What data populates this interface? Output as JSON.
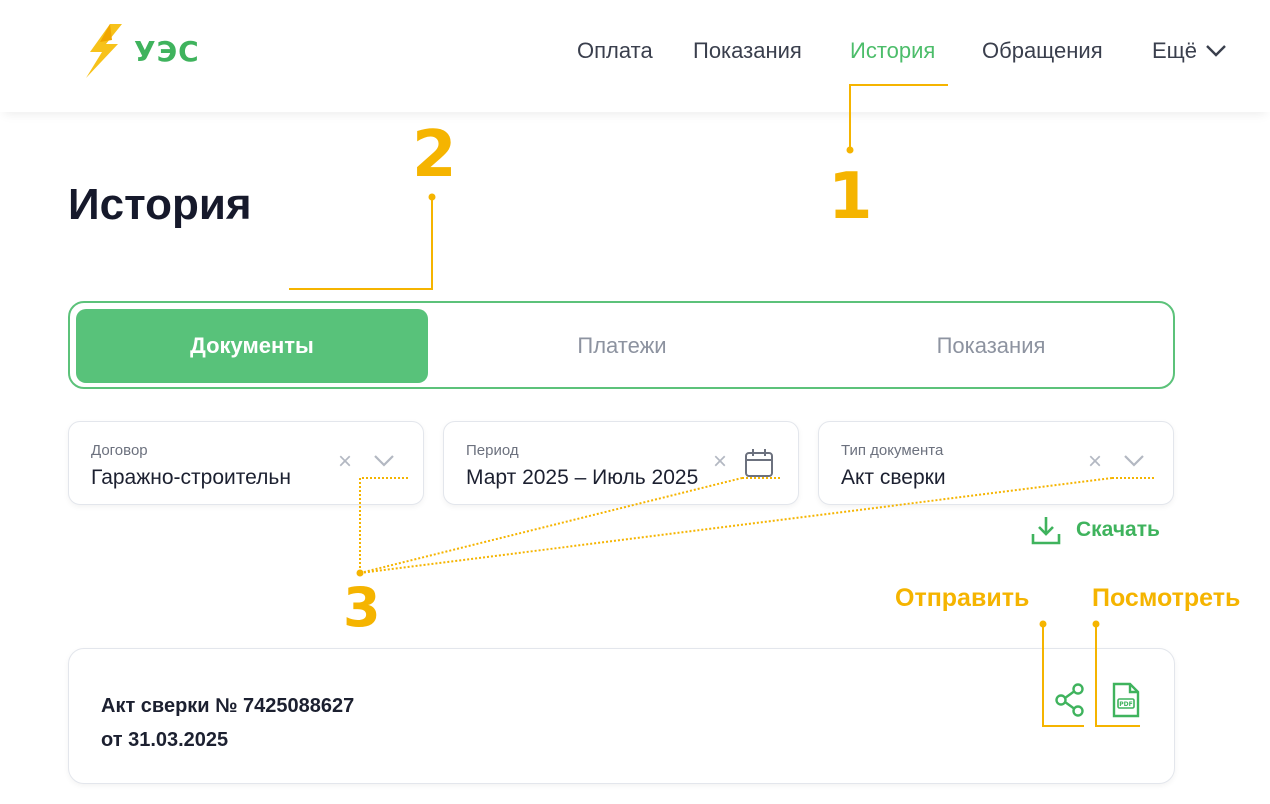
{
  "header": {
    "logo_text": "УЭС",
    "nav": [
      {
        "label": "Оплата"
      },
      {
        "label": "Показания"
      },
      {
        "label": "История"
      },
      {
        "label": "Обращения"
      },
      {
        "label": "Ещё"
      }
    ]
  },
  "page": {
    "title": "История"
  },
  "tabs": [
    {
      "label": "Документы",
      "active": true
    },
    {
      "label": "Платежи",
      "active": false
    },
    {
      "label": "Показания",
      "active": false
    }
  ],
  "filters": {
    "contract": {
      "label": "Договор",
      "value": "Гаражно-строительн"
    },
    "period": {
      "label": "Период",
      "value": "Март 2025 – Июль 2025"
    },
    "doc_type": {
      "label": "Тип документа",
      "value": "Акт сверки"
    }
  },
  "download": {
    "label": "Скачать"
  },
  "document": {
    "title_line1": "Акт сверки № 7425088627",
    "title_line2": "от 31.03.2025"
  },
  "annotations": {
    "n1": "1",
    "n2": "2",
    "n3": "3",
    "send": "Отправить",
    "view": "Посмотреть"
  },
  "colors": {
    "brand_green": "#58c27a",
    "annotation_yellow": "#f5b400"
  }
}
